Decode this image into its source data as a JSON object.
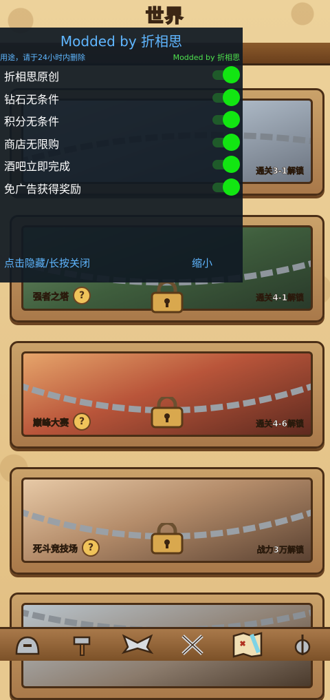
{
  "header": {
    "title": "世界"
  },
  "cards": [
    {
      "scene": "scene-1",
      "mode_name": "",
      "unlock_text": "通关3-1解锁",
      "has_help": false
    },
    {
      "scene": "scene-2",
      "mode_name": "强者之塔",
      "unlock_text": "通关4-1解锁",
      "has_help": true
    },
    {
      "scene": "scene-3",
      "mode_name": "巅峰大赛",
      "unlock_text": "通关4-6解锁",
      "has_help": true
    },
    {
      "scene": "scene-4",
      "mode_name": "死斗竞技场",
      "unlock_text": "战力3万解锁",
      "has_help": true
    },
    {
      "scene": "scene-5",
      "mode_name": "",
      "unlock_text": "",
      "has_help": false
    }
  ],
  "help_glyph": "?",
  "mod_menu": {
    "title": "Modded by 折相思",
    "warning": "用途，请于24小时内删除",
    "credit": "Modded by 折相思",
    "items": [
      {
        "label": "折相思原创",
        "enabled": true
      },
      {
        "label": "钻石无条件",
        "enabled": true
      },
      {
        "label": "积分无条件",
        "enabled": true
      },
      {
        "label": "商店无限购",
        "enabled": true
      },
      {
        "label": "酒吧立即完成",
        "enabled": true
      },
      {
        "label": "免广告获得奖励",
        "enabled": true
      }
    ],
    "hide_label": "点击隐藏/长按关闭",
    "minimize_label": "缩小"
  },
  "colors": {
    "menu_accent": "#5fb6ff",
    "toggle_on": "#12e612",
    "credit_green": "#4ee04e",
    "wood": "#a9794a"
  },
  "bottom_nav": {
    "icons": [
      "helmet-icon",
      "hammer-icon",
      "wings-icon",
      "crossed-swords-icon",
      "map-icon",
      "gear-sword-icon"
    ]
  }
}
